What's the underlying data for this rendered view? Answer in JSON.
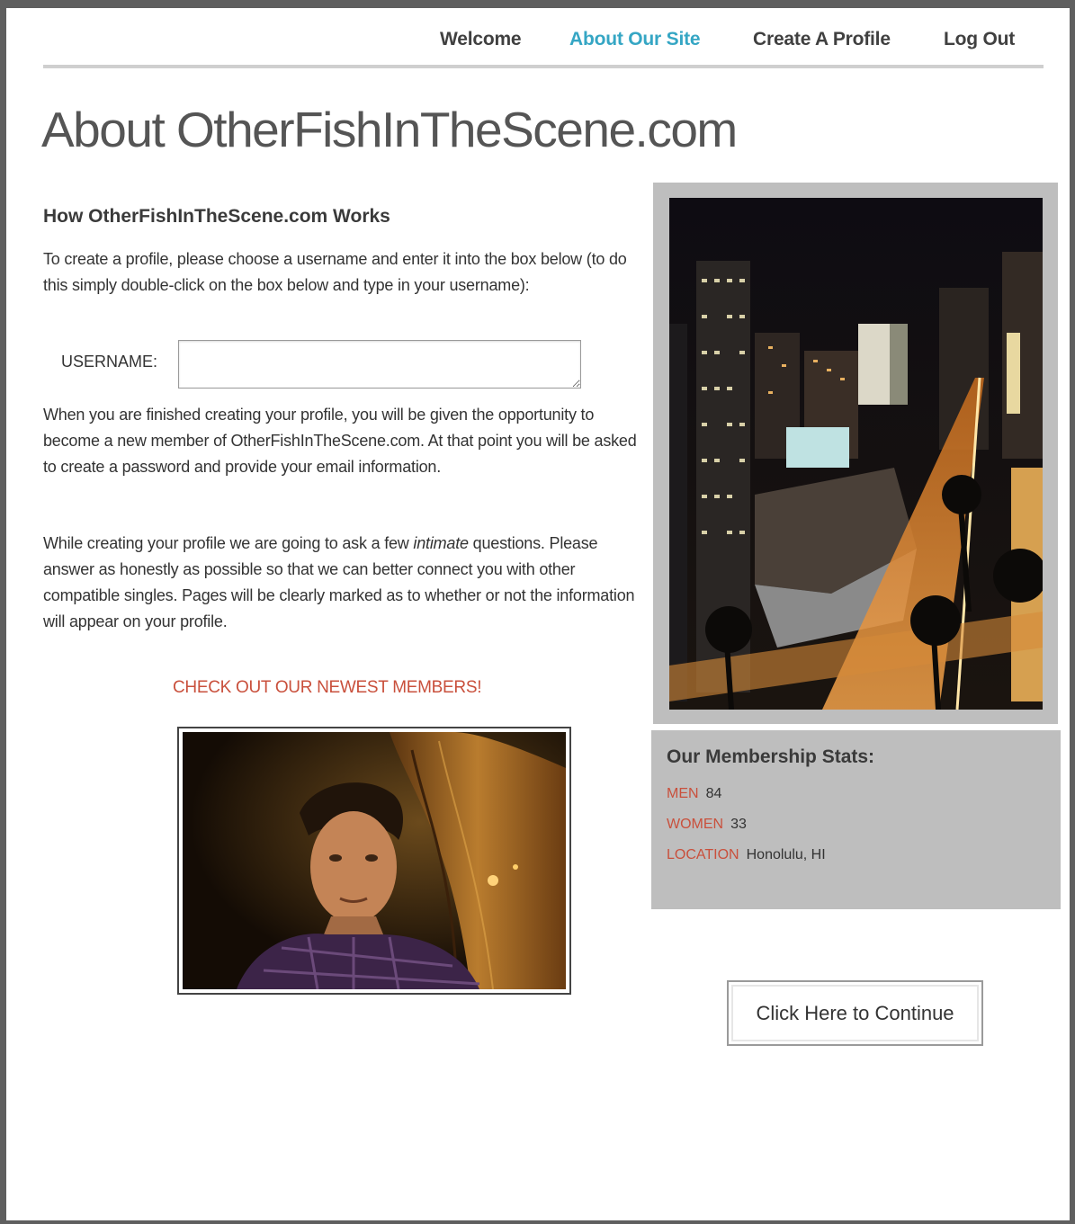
{
  "nav": {
    "items": [
      {
        "label": "Welcome",
        "active": false
      },
      {
        "label": "About Our Site",
        "active": true
      },
      {
        "label": "Create A Profile",
        "active": false
      },
      {
        "label": "Log Out",
        "active": false
      }
    ]
  },
  "page": {
    "title": "About OtherFishInTheScene.com"
  },
  "how_it_works": {
    "heading": "How OtherFishInTheScene.com Works",
    "intro": "To create a profile, please choose a username and enter it into the box below (to do this simply double-click on the box below and type in your username):",
    "username_label": "USERNAME:",
    "username_value": "",
    "after_profile": "When you are finished creating your profile, you will be given the opportunity to become a new member of OtherFishInTheScene.com. At that point you will be asked to create a password and provide your email information.",
    "questions_before": "While creating your profile we are going to ask a few ",
    "questions_emphasis": "intimate",
    "questions_after": " questions. Please answer as honestly as possible so that we can better connect you with other compatible singles. Pages will be clearly marked as to whether or not the information will appear on your profile."
  },
  "newest_members": {
    "link_label": "CHECK OUT OUR NEWEST MEMBERS!"
  },
  "stats": {
    "title": "Our Membership Stats:",
    "rows": [
      {
        "key": "MEN",
        "value": "84"
      },
      {
        "key": "WOMEN",
        "value": "33"
      },
      {
        "key": "LOCATION",
        "value": "Honolulu, HI"
      }
    ]
  },
  "continue_button": {
    "label": "Click Here to Continue"
  },
  "colors": {
    "nav_active": "#35a6c4",
    "accent_red": "#c9503c",
    "panel_gray": "#bebebe",
    "frame": "#5f5f5f"
  }
}
